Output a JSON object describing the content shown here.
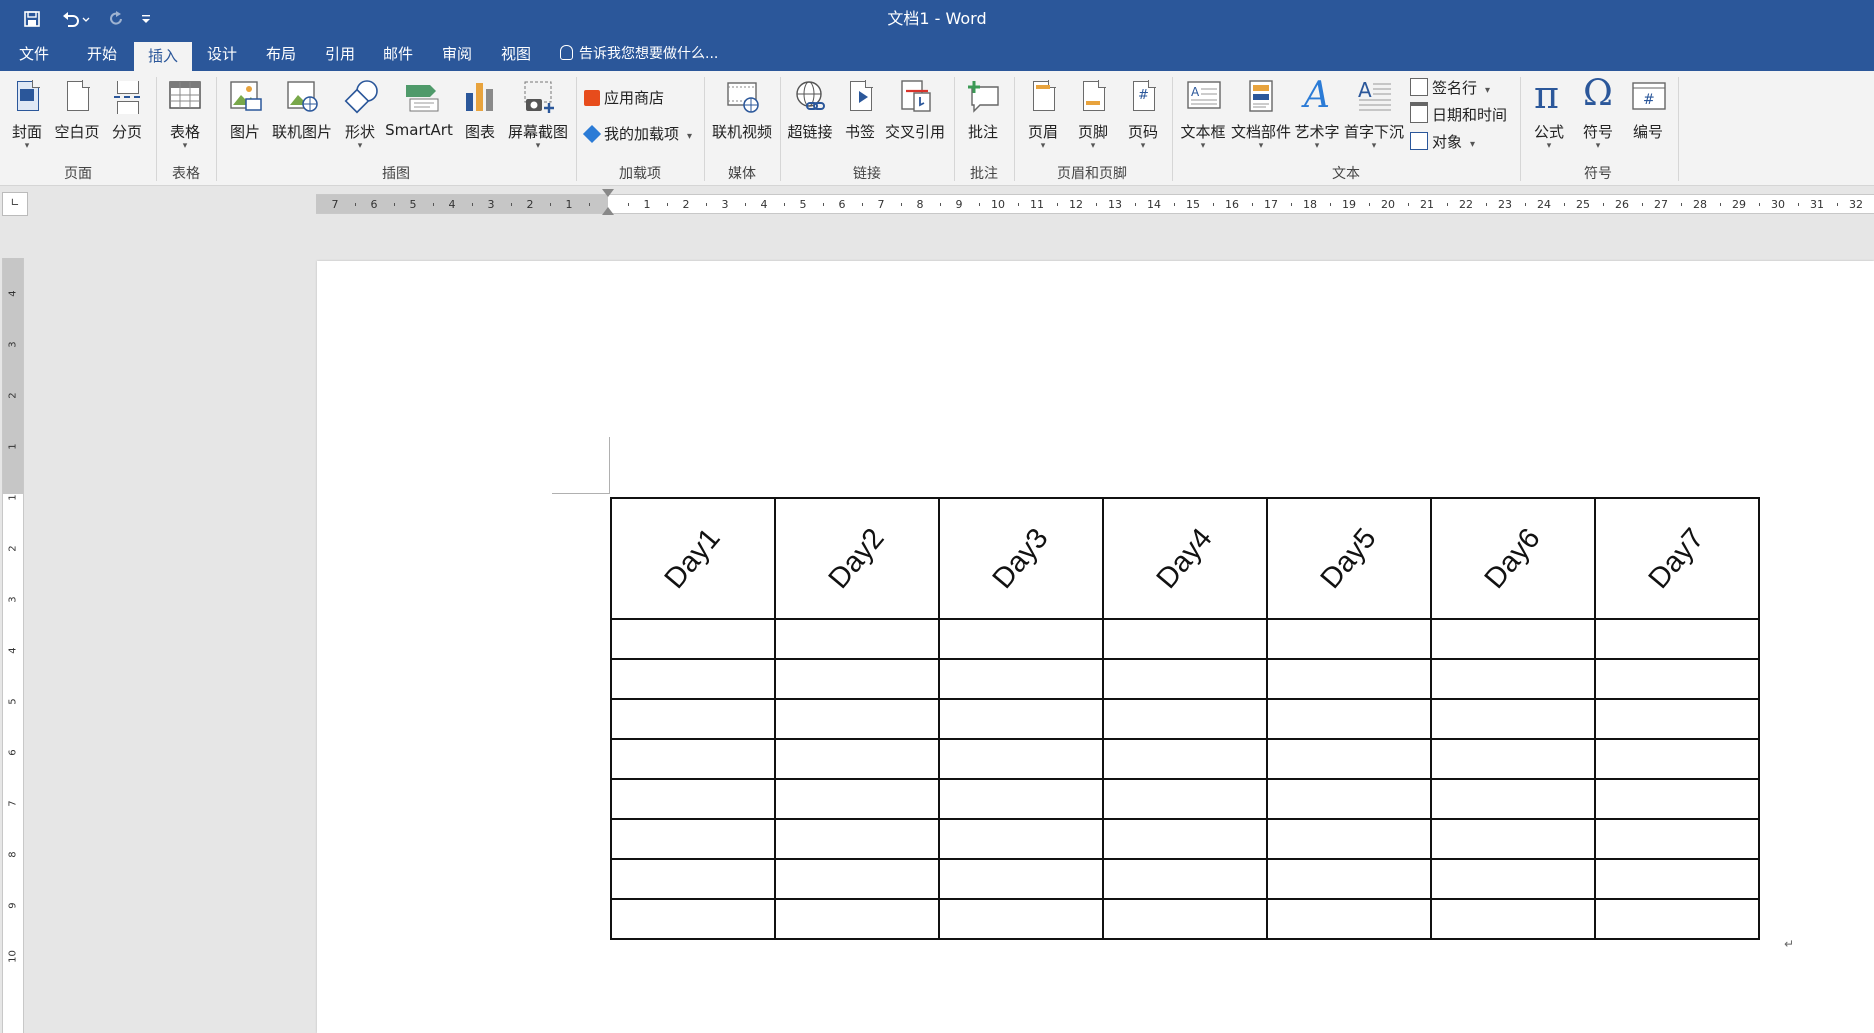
{
  "window": {
    "title": "文档1 - Word"
  },
  "quick_access": [
    {
      "name": "save-icon",
      "glyph": "🖫"
    },
    {
      "name": "undo-icon",
      "glyph": "↶"
    },
    {
      "name": "redo-icon",
      "glyph": "↻"
    },
    {
      "name": "customize-qat-icon",
      "glyph": "⌄"
    }
  ],
  "tabs": [
    "文件",
    "开始",
    "插入",
    "设计",
    "布局",
    "引用",
    "邮件",
    "审阅",
    "视图"
  ],
  "active_tab": "插入",
  "tell_me": "告诉我您想要做什么...",
  "ribbon": {
    "page": {
      "label": "页面",
      "cover": "封面",
      "blank": "空白页",
      "break": "分页"
    },
    "tables": {
      "label": "表格",
      "table": "表格"
    },
    "illustrations": {
      "label": "插图",
      "pictures": "图片",
      "online_pictures": "联机图片",
      "shapes": "形状",
      "smartart": "SmartArt",
      "chart": "图表",
      "screenshot": "屏幕截图"
    },
    "addins": {
      "label": "加载项",
      "store": "应用商店",
      "my_addins": "我的加载项"
    },
    "media": {
      "label": "媒体",
      "online_video": "联机视频"
    },
    "links": {
      "label": "链接",
      "hyperlink": "超链接",
      "bookmark": "书签",
      "cross_ref": "交叉引用"
    },
    "comments": {
      "label": "批注",
      "comment": "批注"
    },
    "header_footer": {
      "label": "页眉和页脚",
      "header": "页眉",
      "footer": "页脚",
      "page_number": "页码"
    },
    "text": {
      "label": "文本",
      "text_box": "文本框",
      "quick_parts": "文档部件",
      "wordart": "艺术字",
      "drop_cap": "首字下沉",
      "signature": "签名行",
      "datetime": "日期和时间",
      "object": "对象"
    },
    "symbols": {
      "label": "符号",
      "equation": "公式",
      "symbol": "符号",
      "number": "编号"
    }
  },
  "ruler": {
    "corner": "∟",
    "left_ticks": [
      "7",
      "6",
      "5",
      "4",
      "3",
      "2",
      "1"
    ],
    "right_ticks": [
      "1",
      "2",
      "3",
      "4",
      "5",
      "6",
      "7",
      "8",
      "9",
      "10",
      "11",
      "12",
      "13",
      "14",
      "15",
      "16",
      "17",
      "18",
      "19",
      "20",
      "21",
      "22",
      "23",
      "24",
      "25",
      "26",
      "27",
      "28",
      "29",
      "30",
      "31",
      "32"
    ],
    "vertical_ticks": [
      "4",
      "3",
      "2",
      "1",
      "1",
      "2",
      "3",
      "4",
      "5",
      "6",
      "7",
      "8",
      "9",
      "10"
    ]
  },
  "table": {
    "headers": [
      "Day1",
      "Day2",
      "Day3",
      "Day4",
      "Day5",
      "Day6",
      "Day7"
    ],
    "empty_rows": 8
  },
  "paragraph_mark": "↵"
}
